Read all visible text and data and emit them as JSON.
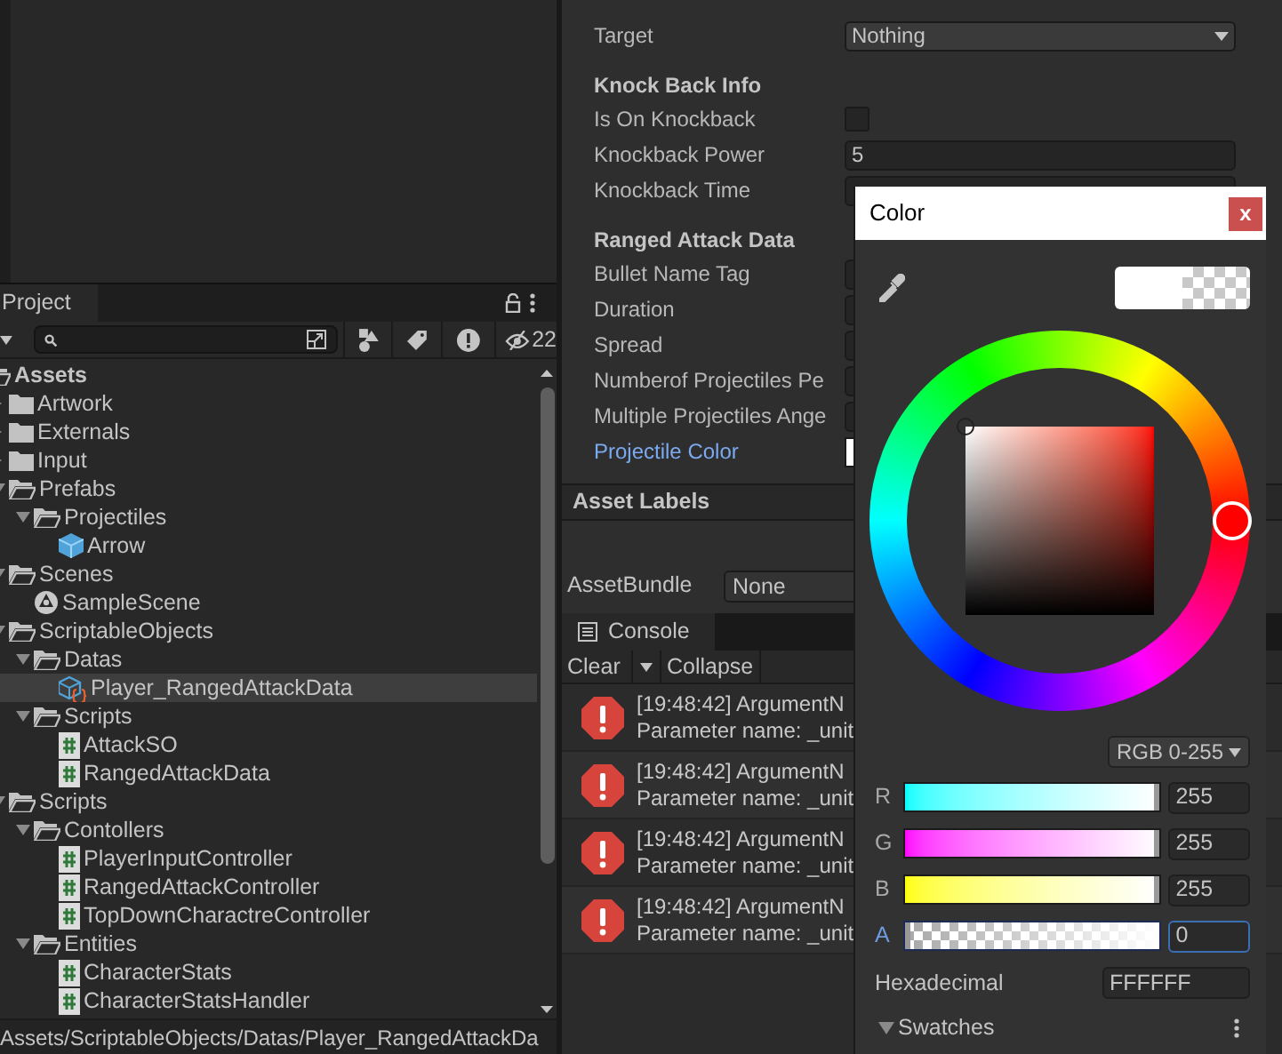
{
  "project": {
    "tab": "Project",
    "hidden_count": "22",
    "tree": [
      {
        "name": "Assets",
        "kind": "folder",
        "expanded": true,
        "selected": false,
        "children": [
          {
            "name": "Artwork",
            "kind": "folder",
            "expanded": false,
            "selected": false
          },
          {
            "name": "Externals",
            "kind": "folder",
            "expanded": false,
            "selected": false
          },
          {
            "name": "Input",
            "kind": "folder",
            "expanded": false,
            "selected": false
          },
          {
            "name": "Prefabs",
            "kind": "folder",
            "expanded": true,
            "selected": false,
            "children": [
              {
                "name": "Projectiles",
                "kind": "folder",
                "expanded": true,
                "selected": false,
                "children": [
                  {
                    "name": "Arrow",
                    "kind": "prefab",
                    "selected": false
                  }
                ]
              }
            ]
          },
          {
            "name": "Scenes",
            "kind": "folder",
            "expanded": true,
            "selected": false,
            "children": [
              {
                "name": "SampleScene",
                "kind": "scene",
                "selected": false
              }
            ]
          },
          {
            "name": "ScriptableObjects",
            "kind": "folder",
            "expanded": true,
            "selected": false,
            "children": [
              {
                "name": "Datas",
                "kind": "folder",
                "expanded": true,
                "selected": false,
                "children": [
                  {
                    "name": "Player_RangedAttackData",
                    "kind": "scriptable",
                    "selected": true
                  }
                ]
              },
              {
                "name": "Scripts",
                "kind": "folder",
                "expanded": true,
                "selected": false,
                "children": [
                  {
                    "name": "AttackSO",
                    "kind": "script",
                    "selected": false
                  },
                  {
                    "name": "RangedAttackData",
                    "kind": "script",
                    "selected": false
                  }
                ]
              }
            ]
          },
          {
            "name": "Scripts",
            "kind": "folder",
            "expanded": true,
            "selected": false,
            "children": [
              {
                "name": "Contollers",
                "kind": "folder",
                "expanded": true,
                "selected": false,
                "children": [
                  {
                    "name": "PlayerInputController",
                    "kind": "script",
                    "selected": false
                  },
                  {
                    "name": "RangedAttackController",
                    "kind": "script",
                    "selected": false
                  },
                  {
                    "name": "TopDownCharactreController",
                    "kind": "script",
                    "selected": false
                  }
                ]
              },
              {
                "name": "Entities",
                "kind": "folder",
                "expanded": true,
                "selected": false,
                "children": [
                  {
                    "name": "CharacterStats",
                    "kind": "script",
                    "selected": false
                  },
                  {
                    "name": "CharacterStatsHandler",
                    "kind": "script",
                    "selected": false
                  }
                ]
              }
            ]
          }
        ]
      }
    ],
    "path": "Assets/ScriptableObjects/Datas/Player_RangedAttackDa"
  },
  "inspector": {
    "sections": [
      {
        "rows": [
          {
            "label": "Target",
            "kind": "dropdown",
            "value": "Nothing",
            "active": false
          }
        ]
      },
      {
        "header": "Knock Back Info",
        "rows": [
          {
            "label": "Is On Knockback",
            "kind": "checkbox",
            "checked": false,
            "active": false
          },
          {
            "label": "Knockback Power",
            "kind": "number",
            "value": "5",
            "active": false
          },
          {
            "label": "Knockback Time",
            "kind": "number",
            "active": false
          }
        ]
      },
      {
        "header": "Ranged Attack Data",
        "rows": [
          {
            "label": "Bullet Name Tag",
            "kind": "number",
            "active": false
          },
          {
            "label": "Duration",
            "kind": "number",
            "active": false
          },
          {
            "label": "Spread",
            "kind": "number",
            "active": false
          },
          {
            "label": "Numberof Projectiles Pe",
            "kind": "number",
            "active": false
          },
          {
            "label": "Multiple Projectiles Ange",
            "kind": "number",
            "active": false
          },
          {
            "label": "Projectile Color",
            "kind": "color",
            "active": true
          }
        ]
      }
    ]
  },
  "asset_labels": {
    "title": "Asset Labels",
    "bundle_label": "AssetBundle",
    "bundle_value": "None"
  },
  "console": {
    "tab": "Console",
    "buttons": [
      "Clear",
      "Collapse"
    ],
    "logs": [
      {
        "line1": "[19:48:42] ArgumentN",
        "line2": "Parameter name: _unit"
      },
      {
        "line1": "[19:48:42] ArgumentN",
        "line2": "Parameter name: _unit"
      },
      {
        "line1": "[19:48:42] ArgumentN",
        "line2": "Parameter name: _unit"
      },
      {
        "line1": "[19:48:42] ArgumentN",
        "line2": "Parameter name: _unit"
      }
    ]
  },
  "color_picker": {
    "title": "Color",
    "close": "x",
    "mode": "RGB 0-255",
    "channels": [
      {
        "label": "R",
        "kind": "red",
        "value": "255",
        "level": 1,
        "selected": false
      },
      {
        "label": "G",
        "kind": "green",
        "value": "255",
        "level": 1,
        "selected": false
      },
      {
        "label": "B",
        "kind": "blue",
        "value": "255",
        "level": 1,
        "selected": false
      },
      {
        "label": "A",
        "kind": "alpha",
        "value": "0",
        "level": 0,
        "selected": true
      }
    ],
    "hex_label": "Hexadecimal",
    "hex": "FFFFFF",
    "swatches": "Swatches",
    "swatches_expanded": true
  }
}
